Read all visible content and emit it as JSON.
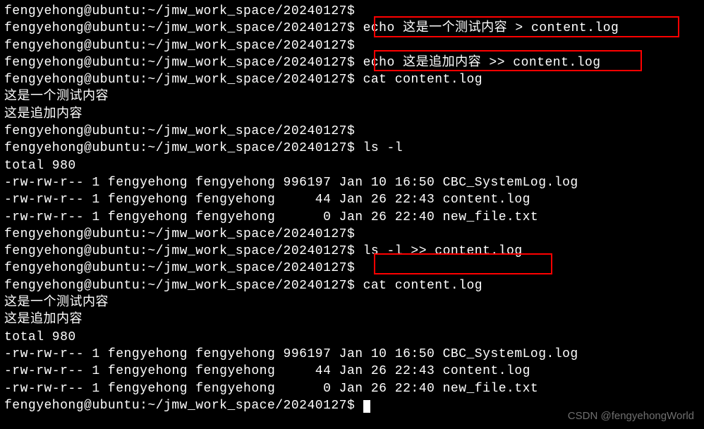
{
  "terminal": {
    "lines": [
      "fengyehong@ubuntu:~/jmw_work_space/20240127$",
      "fengyehong@ubuntu:~/jmw_work_space/20240127$ echo 这是一个测试内容 > content.log",
      "fengyehong@ubuntu:~/jmw_work_space/20240127$",
      "fengyehong@ubuntu:~/jmw_work_space/20240127$ echo 这是追加内容 >> content.log",
      "fengyehong@ubuntu:~/jmw_work_space/20240127$ cat content.log",
      "这是一个测试内容",
      "这是追加内容",
      "fengyehong@ubuntu:~/jmw_work_space/20240127$",
      "fengyehong@ubuntu:~/jmw_work_space/20240127$ ls -l",
      "total 980",
      "-rw-rw-r-- 1 fengyehong fengyehong 996197 Jan 10 16:50 CBC_SystemLog.log",
      "-rw-rw-r-- 1 fengyehong fengyehong     44 Jan 26 22:43 content.log",
      "-rw-rw-r-- 1 fengyehong fengyehong      0 Jan 26 22:40 new_file.txt",
      "fengyehong@ubuntu:~/jmw_work_space/20240127$",
      "fengyehong@ubuntu:~/jmw_work_space/20240127$ ls -l >> content.log",
      "fengyehong@ubuntu:~/jmw_work_space/20240127$",
      "fengyehong@ubuntu:~/jmw_work_space/20240127$ cat content.log",
      "这是一个测试内容",
      "这是追加内容",
      "total 980",
      "-rw-rw-r-- 1 fengyehong fengyehong 996197 Jan 10 16:50 CBC_SystemLog.log",
      "-rw-rw-r-- 1 fengyehong fengyehong     44 Jan 26 22:43 content.log",
      "-rw-rw-r-- 1 fengyehong fengyehong      0 Jan 26 22:40 new_file.txt",
      "fengyehong@ubuntu:~/jmw_work_space/20240127$ "
    ]
  },
  "watermark": "CSDN @fengyehongWorld"
}
